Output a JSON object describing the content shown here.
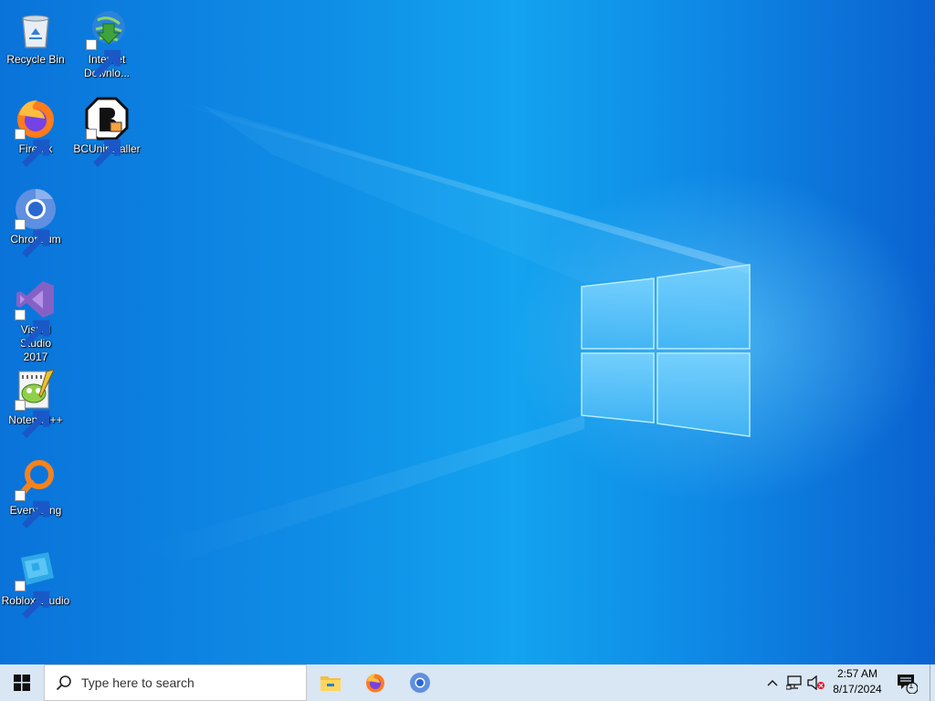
{
  "desktop": {
    "icons": [
      {
        "label": "Recycle Bin",
        "icon": "recycle-bin-icon",
        "shortcut": false
      },
      {
        "label": "Internet Downlo...",
        "icon": "internet-download-manager-icon",
        "shortcut": true
      },
      {
        "label": "Firefox",
        "icon": "firefox-icon",
        "shortcut": true
      },
      {
        "label": "BCUninstaller",
        "icon": "bcuninstaller-icon",
        "shortcut": true
      },
      {
        "label": "Chromium",
        "icon": "chromium-icon",
        "shortcut": true
      },
      {
        "label": "Visual Studio 2017",
        "icon": "visual-studio-icon",
        "shortcut": true
      },
      {
        "label": "Notepad++",
        "icon": "notepad-plus-plus-icon",
        "shortcut": true
      },
      {
        "label": "Everything",
        "icon": "everything-search-icon",
        "shortcut": true
      },
      {
        "label": "Roblox Studio",
        "icon": "roblox-studio-icon",
        "shortcut": true
      }
    ]
  },
  "taskbar": {
    "search_placeholder": "Type here to search",
    "pinned_apps": [
      "file-explorer-icon",
      "firefox-icon",
      "chromium-icon"
    ],
    "tray_icons": [
      "chevron-up-icon",
      "network-icon",
      "volume-muted-icon"
    ],
    "time": "2:57 AM",
    "date": "8/17/2024",
    "notification_count": "1"
  },
  "colors": {
    "desktop_blue": "#0f8ee6",
    "taskbar_bg": "#d9e6f3"
  }
}
